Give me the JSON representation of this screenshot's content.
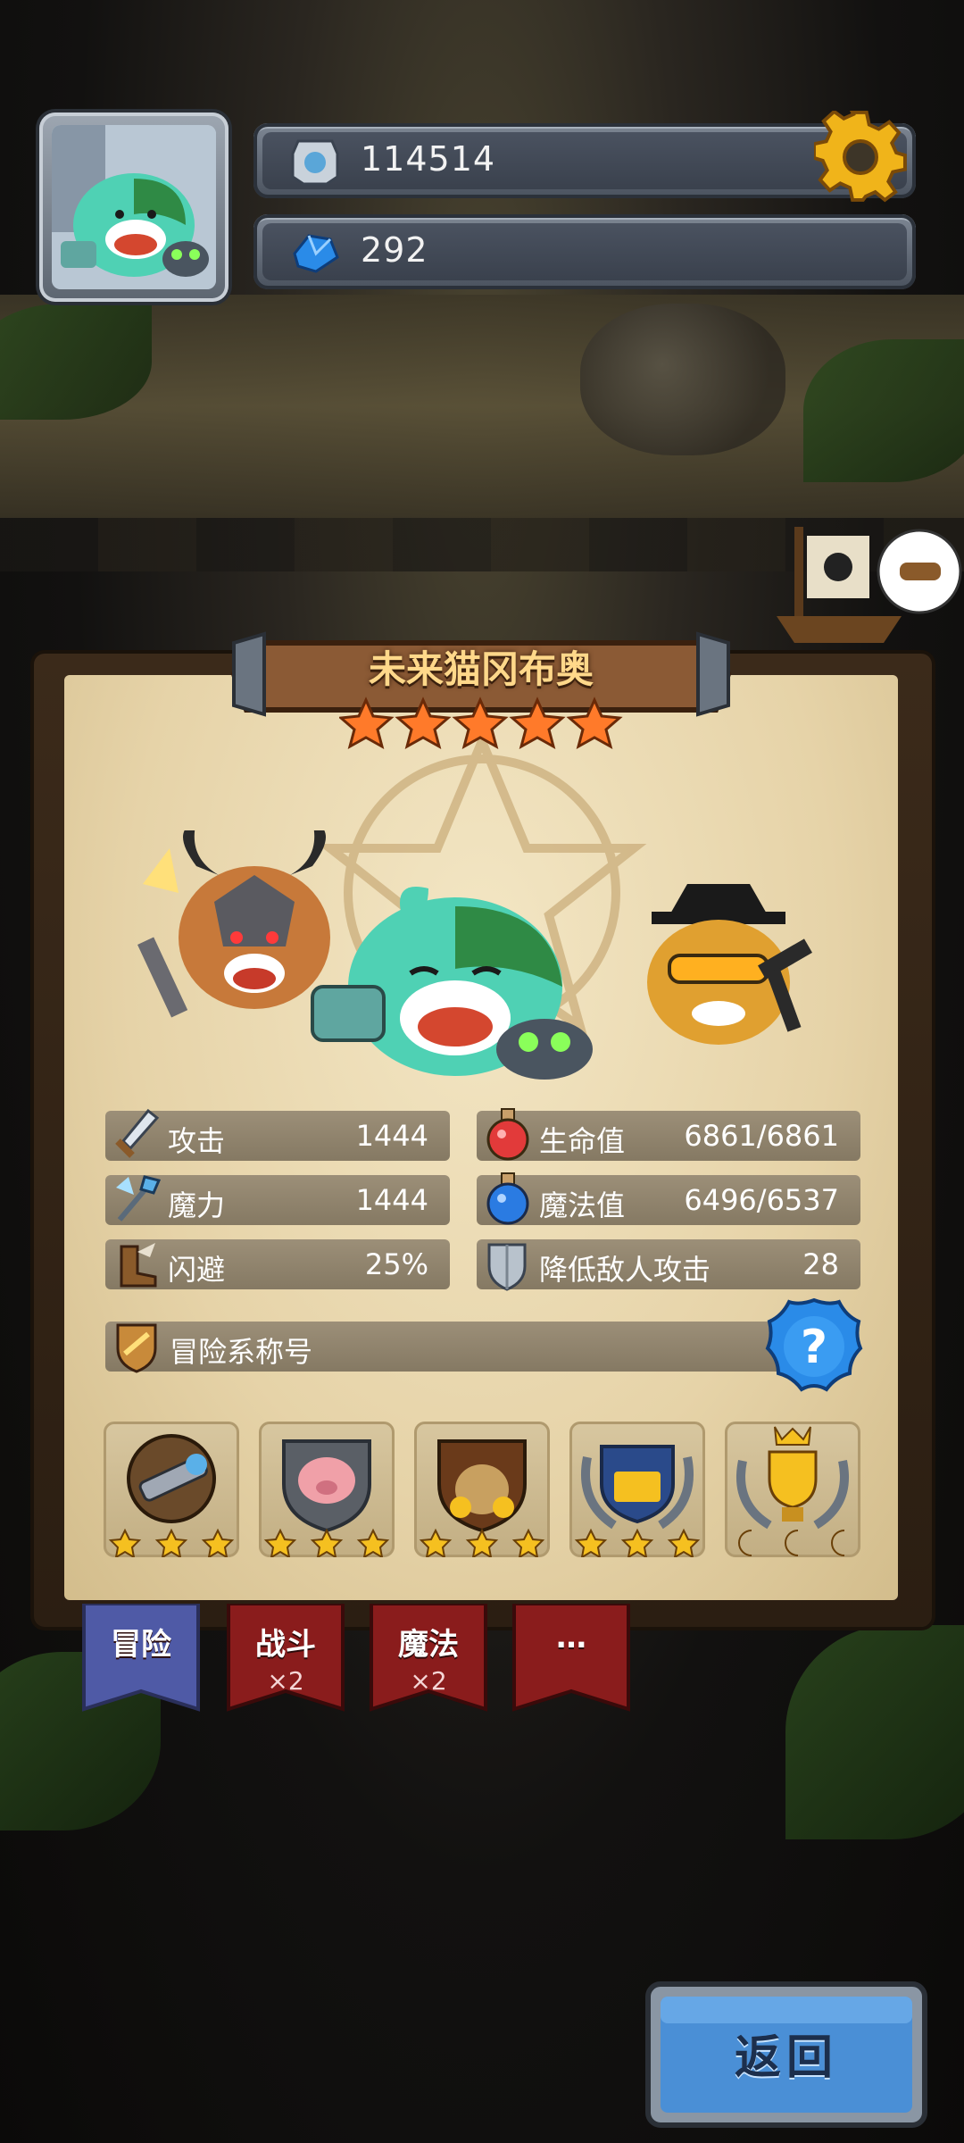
{
  "hud": {
    "gold_value": "114514",
    "gem_value": "292",
    "icons": [
      "silver-coin-icon",
      "blue-gem-icon",
      "gear-icon"
    ]
  },
  "hero": {
    "name": "未来猫冈布奥",
    "stars": 5
  },
  "stats": {
    "attack": {
      "label": "攻击",
      "value": "1444"
    },
    "magic_power": {
      "label": "魔力",
      "value": "1444"
    },
    "dodge": {
      "label": "闪避",
      "value": "25%"
    },
    "hp": {
      "label": "生命值",
      "value": "6861/6861"
    },
    "mp": {
      "label": "魔法值",
      "value": "6496/6537"
    },
    "damage_reduction": {
      "label": "降低敌人攻击",
      "value": "28"
    }
  },
  "adventure_title": {
    "label": "冒险系称号"
  },
  "badges": [
    {
      "name": "telescope-badge",
      "stars": 3
    },
    {
      "name": "pig-shield-badge",
      "stars": 3
    },
    {
      "name": "gold-sack-badge",
      "stars": 3
    },
    {
      "name": "treasure-laurel-badge",
      "stars": 3
    },
    {
      "name": "trophy-crown-badge",
      "moons": 3
    }
  ],
  "tabs": [
    {
      "label": "冒险",
      "mult": ""
    },
    {
      "label": "战斗",
      "mult": "×2"
    },
    {
      "label": "魔法",
      "mult": "×2"
    },
    {
      "label": "…",
      "mult": ""
    }
  ],
  "back_button": {
    "label": "返回"
  },
  "colors": {
    "parchment": "#e6d3a8",
    "stat_bar": "#8f836d",
    "tab_active": "#4f5aa6",
    "tab_inactive": "#8a1c1c",
    "back_button": "#4a8fd6",
    "title_text": "#ffd88a",
    "star": "#ff7a2a"
  }
}
